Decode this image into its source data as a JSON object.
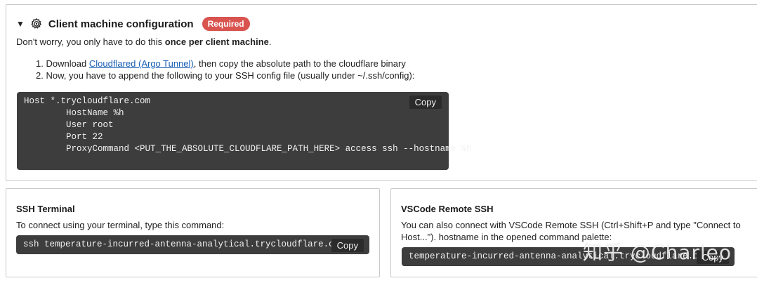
{
  "config": {
    "title": "Client machine configuration",
    "badge": "Required",
    "intro_prefix": "Don't worry, you only have to do this ",
    "intro_bold": "once per client machine",
    "intro_suffix": ".",
    "steps": [
      {
        "prefix": "1. Download ",
        "link": "Cloudflared (Argo Tunnel)",
        "suffix": ", then copy the absolute path to the cloudflare binary"
      },
      {
        "text": "2. Now, you have to append the following to your SSH config file (usually under ~/.ssh/config):"
      }
    ],
    "code": "Host *.trycloudflare.com\n        HostName %h\n        User root\n        Port 22\n        ProxyCommand <PUT_THE_ABSOLUTE_CLOUDFLARE_PATH_HERE> access ssh --hostname %h",
    "copy_label": "Copy"
  },
  "ssh_terminal": {
    "title": "SSH Terminal",
    "description": "To connect using your terminal, type this command:",
    "command": "ssh temperature-incurred-antenna-analytical.trycloudflare.com",
    "copy_label": "Copy"
  },
  "vscode": {
    "title": "VSCode Remote SSH",
    "description": "You can also connect with VSCode Remote SSH (Ctrl+Shift+P and type \"Connect to Host...\"). hostname in the opened command palette:",
    "hostname": "temperature-incurred-antenna-analytical.trycloudflare.com",
    "copy_label": "Copy"
  },
  "watermark": "知乎 @Charleo",
  "colors": {
    "badge": "#d9534f",
    "code_bg": "#3d3d3d",
    "link": "#1a5fb4"
  }
}
